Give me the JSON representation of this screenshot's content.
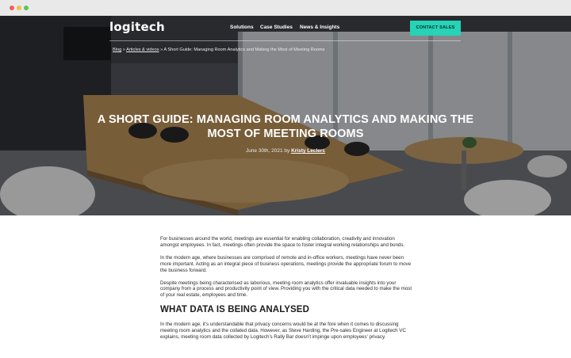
{
  "header": {
    "logo": "logitech",
    "nav": [
      "Solutions",
      "Case Studies",
      "News & Insights"
    ],
    "cta_label": "CONTACT SALES"
  },
  "breadcrumb": {
    "items": [
      "Blog",
      "Articles & videos",
      "A Short Guide: Managing Room Analytics and Making the Most of Meeting Rooms"
    ],
    "separator": "»"
  },
  "hero": {
    "title": "A Short Guide: Managing Room Analytics and Making the Most of Meeting Rooms",
    "date": "June 30th, 2021",
    "by": "by",
    "author": "Kristy Leclerc"
  },
  "article": {
    "paragraphs": [
      "For businesses around the world, meetings are essential for enabling collaboration, creativity and innovation amongst employees. In fact, meetings often provide the space to foster integral working relationships and bonds.",
      "In the modern age, where businesses are comprised of remote and in-office workers, meetings have never been more important. Acting as an integral piece of business operations, meetings provide the appropriate forum to move the business forward.",
      "Despite meetings being characterised as laborious, meeting room analytics offer invaluable insights into your company from a process and productivity point of view. Providing you with the critical data needed to make the most of your real estate, employees and time."
    ],
    "heading": "WHAT DATA IS BEING ANALYSED",
    "paragraph_after": "In the modern age, it’s understandable that privacy concerns would be at the fore when it comes to discussing meeting room analytics and the collated data. However, as Steve Harding, the Pre-sales Engineer at Logitech VC explains, meeting room data collected by Logitech’s Rally Bar doesn’t impinge upon employees’ privacy."
  },
  "colors": {
    "accent": "#26d3b6",
    "hero_overlay": "#1a1b1e"
  }
}
